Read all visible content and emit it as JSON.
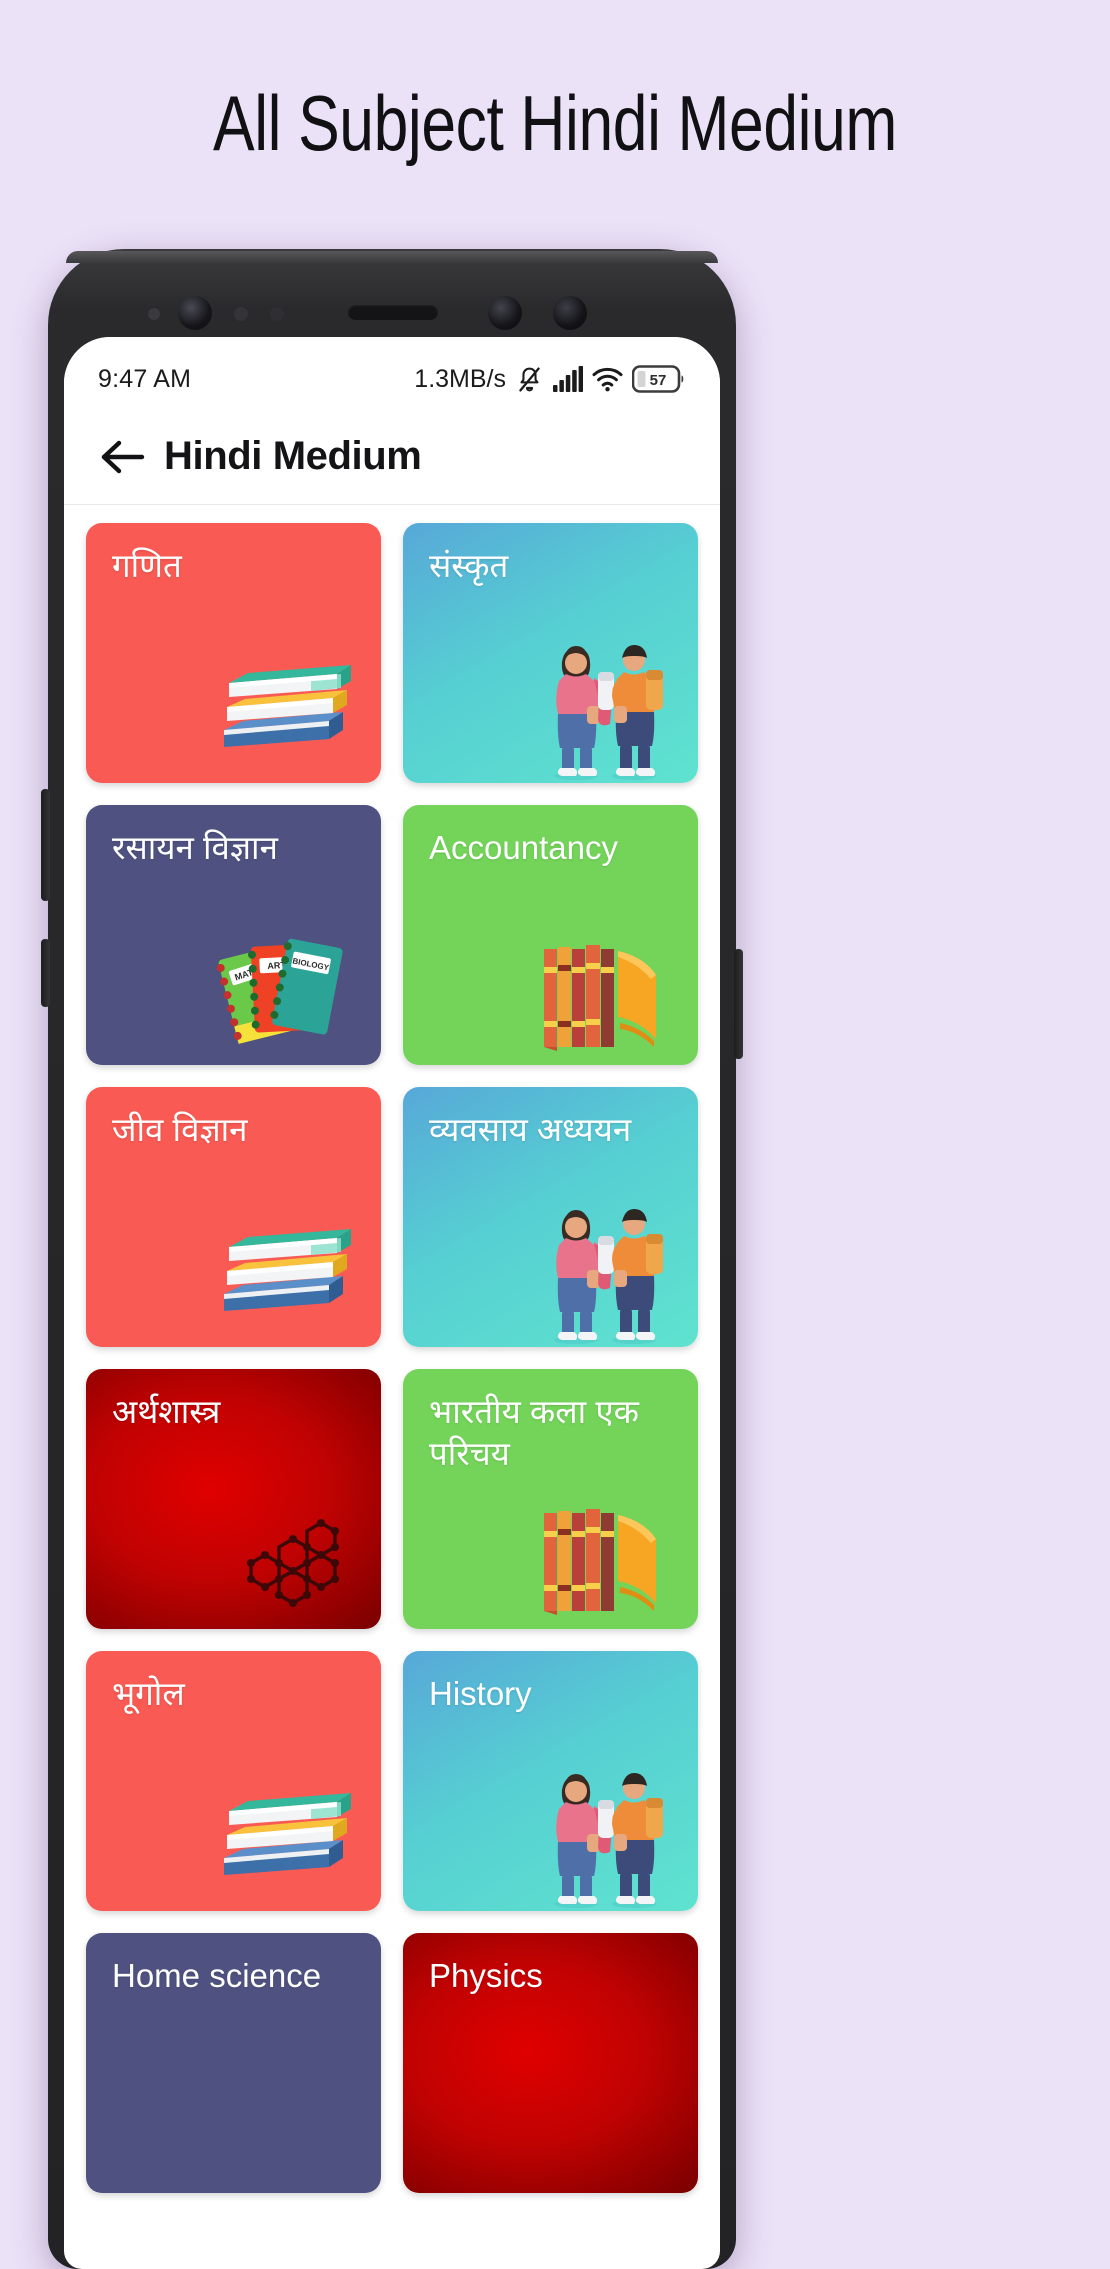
{
  "page": {
    "heading": "All Subject Hindi Medium",
    "background_color": "#ece2f8"
  },
  "status_bar": {
    "time": "9:47 AM",
    "network_speed": "1.3MB/s",
    "icons": [
      "mute-bell-icon",
      "signal-bars-icon",
      "wifi-icon",
      "battery-icon"
    ],
    "battery_level": "57"
  },
  "app_bar": {
    "back_label": "back-arrow",
    "title": "Hindi Medium"
  },
  "grid": {
    "cards": [
      {
        "label": "गणित",
        "bg": "bg-coral",
        "art": "books",
        "color": "#f95a53"
      },
      {
        "label": "संस्कृत",
        "bg": "bg-cyan",
        "art": "students",
        "color": "#56cfd2"
      },
      {
        "label": "रसायन विज्ञान",
        "bg": "bg-slate",
        "art": "notebooks",
        "color": "#4f5280"
      },
      {
        "label": "Accountancy",
        "bg": "bg-green",
        "art": "bookrow",
        "color": "#74d45a"
      },
      {
        "label": "जीव विज्ञान",
        "bg": "bg-coral",
        "art": "books",
        "color": "#f95a53"
      },
      {
        "label": "व्यवसाय अध्ययन",
        "bg": "bg-cyan",
        "art": "students",
        "color": "#56cfd2"
      },
      {
        "label": "अर्थशास्त्र",
        "bg": "bg-red-rad",
        "art": "molecule",
        "color": "#c00202"
      },
      {
        "label": "भारतीय कला एक परिचय",
        "bg": "bg-green",
        "art": "bookrow",
        "color": "#74d45a"
      },
      {
        "label": "भूगोल",
        "bg": "bg-coral",
        "art": "books",
        "color": "#f95a53"
      },
      {
        "label": "History",
        "bg": "bg-cyan",
        "art": "students",
        "color": "#56cfd2"
      },
      {
        "label": "Home science",
        "bg": "bg-slate",
        "art": "none",
        "color": "#4f5280"
      },
      {
        "label": "Physics",
        "bg": "bg-red-rad",
        "art": "none",
        "color": "#c00202"
      }
    ],
    "notebook_labels": [
      "MATH",
      "ART",
      "BIOLOGY"
    ]
  }
}
